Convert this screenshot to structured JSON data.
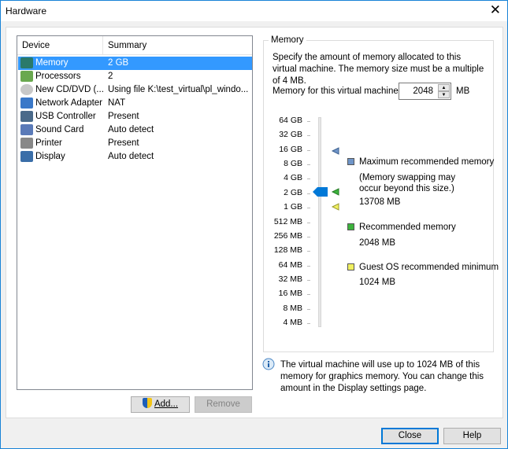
{
  "window": {
    "title": "Hardware",
    "close_icon": "close-icon"
  },
  "device_list": {
    "columns": [
      "Device",
      "Summary"
    ],
    "rows": [
      {
        "device": "Memory",
        "summary": "2 GB",
        "icon": "memory-icon",
        "selected": true
      },
      {
        "device": "Processors",
        "summary": "2",
        "icon": "processor-icon"
      },
      {
        "device": "New CD/DVD (...",
        "summary": "Using file K:\\test_virtual\\pl_windo...",
        "icon": "cd-icon"
      },
      {
        "device": "Network Adapter",
        "summary": "NAT",
        "icon": "network-icon"
      },
      {
        "device": "USB Controller",
        "summary": "Present",
        "icon": "usb-icon"
      },
      {
        "device": "Sound Card",
        "summary": "Auto detect",
        "icon": "speaker-icon"
      },
      {
        "device": "Printer",
        "summary": "Present",
        "icon": "printer-icon"
      },
      {
        "device": "Display",
        "summary": "Auto detect",
        "icon": "monitor-icon"
      }
    ]
  },
  "buttons": {
    "add": "Add...",
    "remove": "Remove",
    "close": "Close",
    "help": "Help"
  },
  "memory": {
    "group_label": "Memory",
    "description": "Specify the amount of memory allocated to this virtual machine. The memory size must be a multiple of 4 MB.",
    "field_label": "Memory for this virtual machine:",
    "value": "2048",
    "unit": "MB",
    "ticks": [
      "64 GB",
      "32 GB",
      "16 GB",
      "8 GB",
      "4 GB",
      "2 GB",
      "1 GB",
      "512 MB",
      "256 MB",
      "128 MB",
      "64 MB",
      "32 MB",
      "16 MB",
      "8 MB",
      "4 MB"
    ],
    "slider_value": "2 GB",
    "legend": {
      "max_label": "Maximum recommended memory",
      "max_note": "(Memory swapping may occur beyond this size.)",
      "max_value": "13708 MB",
      "max_color": "#6f95c8",
      "rec_label": "Recommended memory",
      "rec_value": "2048 MB",
      "rec_color": "#3db33d",
      "min_label": "Guest OS recommended minimum",
      "min_value": "1024 MB",
      "min_color": "#f0f060"
    },
    "info": "The virtual machine will use up to 1024 MB of this memory for graphics memory. You can change this amount in the Display settings page."
  }
}
